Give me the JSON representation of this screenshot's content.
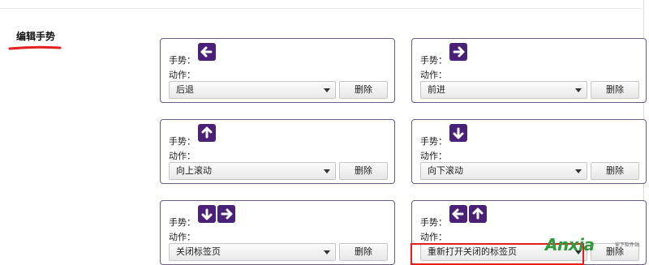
{
  "section_title": "编辑手势",
  "gesture_label": "手势：",
  "action_label": "动作：",
  "delete_label": "删除",
  "gestures": [
    {
      "arrows": [
        "left"
      ],
      "action": "后退"
    },
    {
      "arrows": [
        "right"
      ],
      "action": "前进"
    },
    {
      "arrows": [
        "up"
      ],
      "action": "向上滚动"
    },
    {
      "arrows": [
        "down"
      ],
      "action": "向下滚动"
    },
    {
      "arrows": [
        "down",
        "right"
      ],
      "action": "关闭标签页"
    },
    {
      "arrows": [
        "left",
        "up"
      ],
      "action": "重新打开关闭的标签页"
    }
  ],
  "colors": {
    "icon_bg": "#4b2178",
    "card_border": "#6b5a8c",
    "highlight": "#e22020",
    "underline": "#e22020",
    "watermark": "#2e9b3a"
  },
  "watermark": {
    "text": "Anxia",
    "sub": "安下软件站"
  }
}
